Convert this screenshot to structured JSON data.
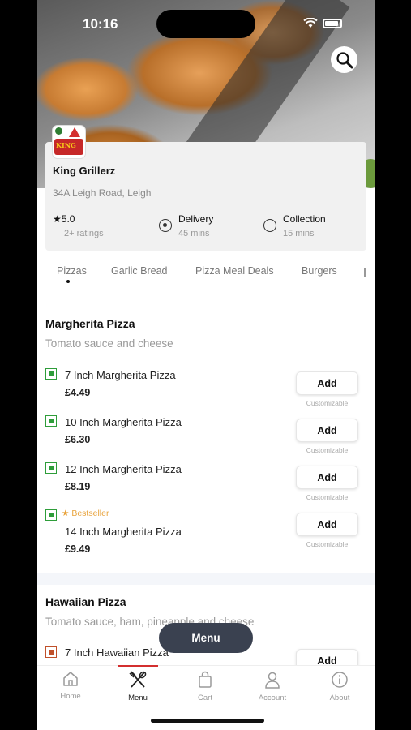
{
  "status_bar": {
    "time": "10:16"
  },
  "restaurant": {
    "name": "King Grillerz",
    "address": "34A Leigh Road, Leigh",
    "rating": "5.0",
    "ratings_count": "2+ ratings",
    "delivery": {
      "label": "Delivery",
      "time": "45 mins",
      "selected": true
    },
    "collection": {
      "label": "Collection",
      "time": "15 mins",
      "selected": false
    },
    "logo_text": "KING"
  },
  "categories": [
    {
      "label": "Pizzas",
      "active": true
    },
    {
      "label": "Garlic Bread",
      "active": false
    },
    {
      "label": "Pizza Meal Deals",
      "active": false
    },
    {
      "label": "Burgers",
      "active": false
    }
  ],
  "sections": [
    {
      "title": "Margherita Pizza",
      "description": "Tomato sauce and cheese",
      "items": [
        {
          "name": "7 Inch Margherita Pizza",
          "price": "£4.49",
          "add": "Add",
          "note": "Customizable"
        },
        {
          "name": "10 Inch Margherita Pizza",
          "price": "£6.30",
          "add": "Add",
          "note": "Customizable"
        },
        {
          "name": "12 Inch Margherita Pizza",
          "price": "£8.19",
          "add": "Add",
          "note": "Customizable"
        },
        {
          "name": "14 Inch Margherita Pizza",
          "price": "£9.49",
          "add": "Add",
          "note": "Customizable",
          "badge": "Bestseller"
        }
      ]
    },
    {
      "title": "Hawaiian Pizza",
      "description": "Tomato sauce, ham, pineapple and cheese",
      "items": [
        {
          "name": "7 Inch Hawaiian Pizza",
          "add": "Add"
        }
      ]
    }
  ],
  "menu_button": "Menu",
  "tabbar": [
    {
      "label": "Home",
      "icon": "home-icon"
    },
    {
      "label": "Menu",
      "icon": "cutlery-icon",
      "active": true
    },
    {
      "label": "Cart",
      "icon": "bag-icon"
    },
    {
      "label": "Account",
      "icon": "user-icon"
    },
    {
      "label": "About",
      "icon": "info-icon"
    }
  ],
  "colors": {
    "accent": "#d32f2f",
    "veg": "#2e9d3a",
    "bestseller": "#e8a23a",
    "fab": "#3a4150"
  }
}
